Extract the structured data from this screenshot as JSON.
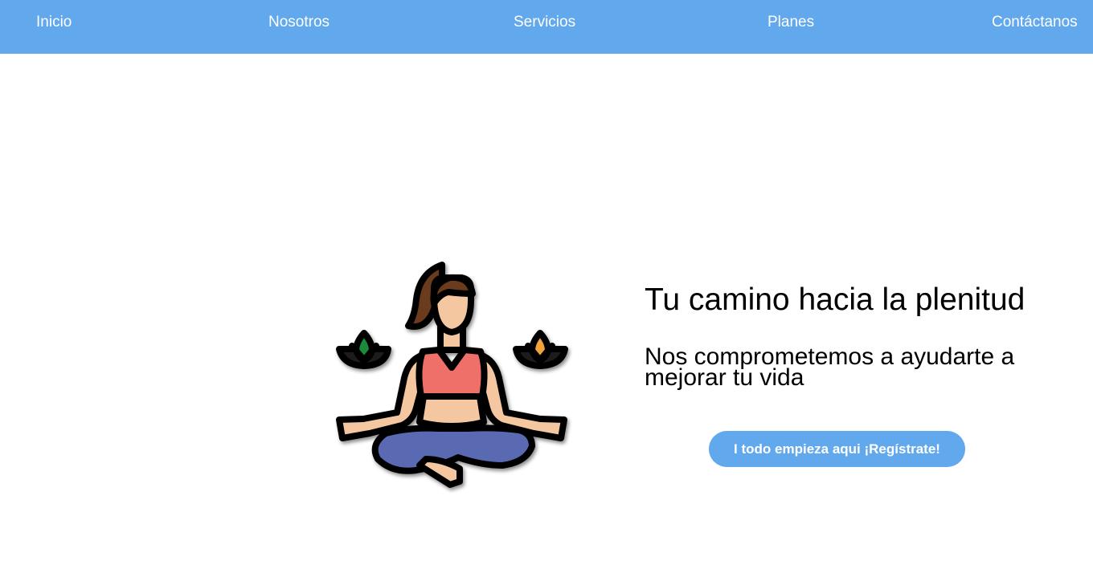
{
  "nav": {
    "items": [
      {
        "label": "Inicio"
      },
      {
        "label": "Nosotros"
      },
      {
        "label": "Servicios"
      },
      {
        "label": "Planes"
      },
      {
        "label": "Contáctanos"
      }
    ]
  },
  "hero": {
    "illustration_icon": "meditating-woman-yoga-icon",
    "title": "Tu camino hacia la plenitud",
    "subtitle": "Nos comprometemos a ayudarte a mejorar tu vida",
    "cta_label": "I todo empieza aqui ¡Regístrate!"
  },
  "colors": {
    "accent": "#62a8ec",
    "text": "#000000",
    "background": "#ffffff"
  }
}
